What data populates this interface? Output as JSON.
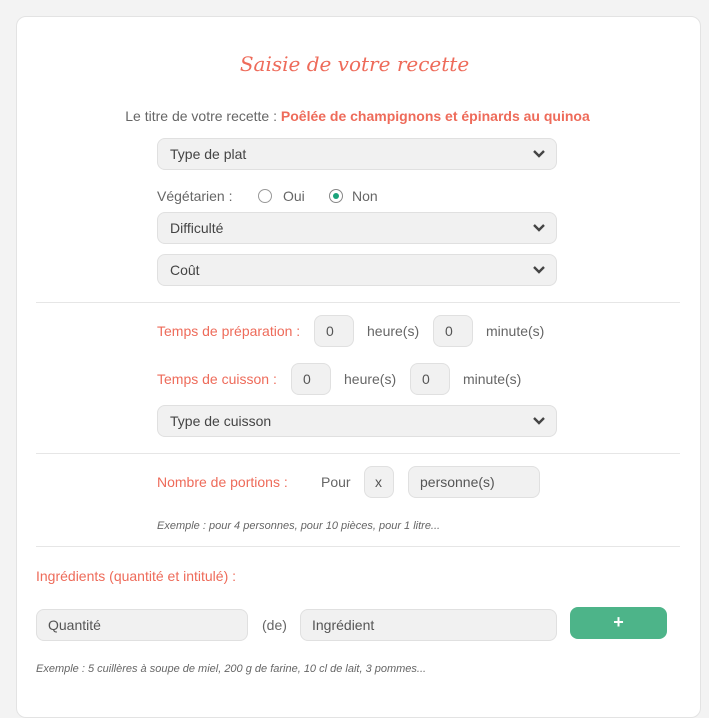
{
  "form": {
    "title": "Saisie de votre recette",
    "recipe_title_label": "Le titre de votre recette :",
    "recipe_title_value": "Poêlée de champignons et épinards au quinoa",
    "dish_type": "Type de plat",
    "vegetarian_label": "Végétarien :",
    "vegetarian_yes": "Oui",
    "vegetarian_no": "Non",
    "vegetarian_selected": "Non",
    "difficulty": "Difficulté",
    "cost": "Coût"
  },
  "times": {
    "prep_label": "Temps de préparation :",
    "cook_label": "Temps de cuisson :",
    "hours_unit": "heure(s)",
    "minutes_unit": "minute(s)",
    "prep_hours": "0",
    "prep_minutes": "0",
    "cook_hours": "0",
    "cook_minutes": "0",
    "cooking_type": "Type de cuisson"
  },
  "portions": {
    "label": "Nombre de portions :",
    "prefix": "Pour",
    "value": "x",
    "unit_placeholder": "personne(s)",
    "example": "Exemple : pour 4 personnes, pour 10 pièces, pour 1 litre..."
  },
  "ingredients": {
    "label": "Ingrédients (quantité et intitulé) :",
    "quantity_placeholder": "Quantité",
    "of_label": "(de)",
    "ingredient_placeholder": "Ingrédient",
    "add_label": "+",
    "example": "Exemple : 5 cuillères à soupe de miel, 200 g de farine, 10 cl de lait, 3 pommes..."
  },
  "colors": {
    "accent": "#ee6b5a",
    "button": "#4db489",
    "radio_checked": "#1aa37a"
  }
}
